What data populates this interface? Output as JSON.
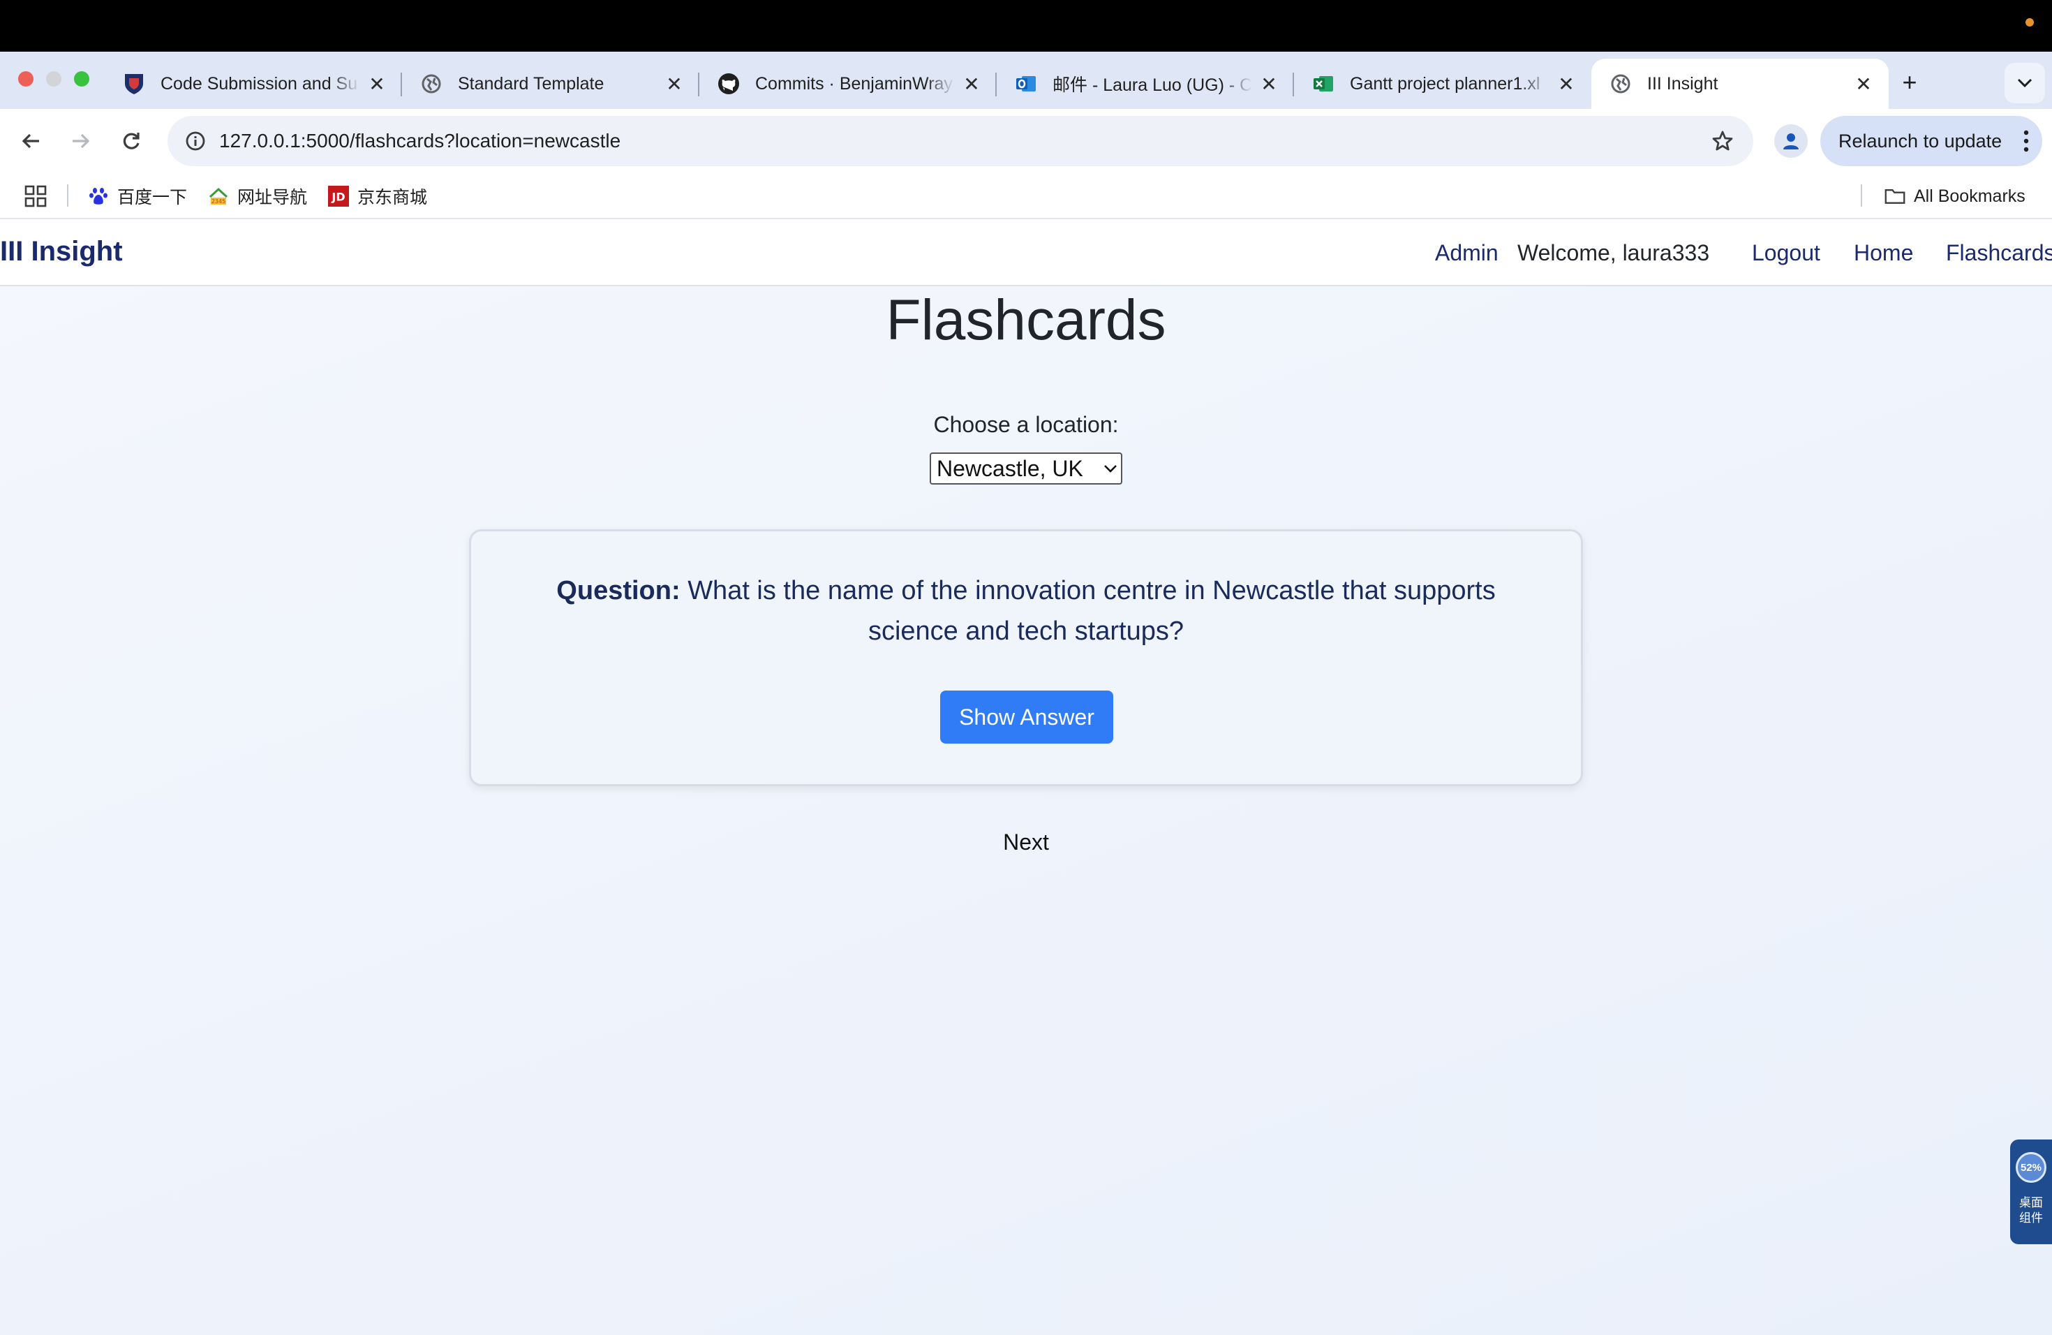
{
  "browser": {
    "tabs": [
      {
        "title": "Code Submission and Su",
        "icon": "university-shield-icon",
        "active": false
      },
      {
        "title": "Standard Template",
        "icon": "globe-icon",
        "active": false
      },
      {
        "title": "Commits · BenjaminWray",
        "icon": "github-icon",
        "active": false
      },
      {
        "title": "邮件 - Laura Luo (UG) - C",
        "icon": "outlook-icon",
        "active": false
      },
      {
        "title": "Gantt project planner1.xl",
        "icon": "excel-icon",
        "active": false
      },
      {
        "title": "III Insight",
        "icon": "globe-icon",
        "active": true
      }
    ],
    "address": "127.0.0.1:5000/flashcards?location=newcastle",
    "relaunch_label": "Relaunch to update",
    "bookmarks": [
      {
        "label": "百度一下",
        "icon": "baidu-paw-icon"
      },
      {
        "label": "网址导航",
        "icon": "hao123-icon"
      },
      {
        "label": "京东商城",
        "icon": "jd-icon"
      }
    ],
    "all_bookmarks_label": "All Bookmarks"
  },
  "navbar": {
    "brand": "III Insight",
    "admin": "Admin",
    "welcome": "Welcome, laura333",
    "logout": "Logout",
    "home": "Home",
    "flashcards": "Flashcards"
  },
  "main": {
    "title": "Flashcards",
    "location_label": "Choose a location:",
    "location_selected": "Newcastle, UK",
    "question_prefix": "Question:",
    "question_text": "What is the name of the innovation centre in Newcastle that supports science and tech startups?",
    "show_answer": "Show Answer",
    "next": "Next"
  },
  "widget": {
    "percent": "52%",
    "label_line1": "桌面",
    "label_line2": "组件"
  }
}
